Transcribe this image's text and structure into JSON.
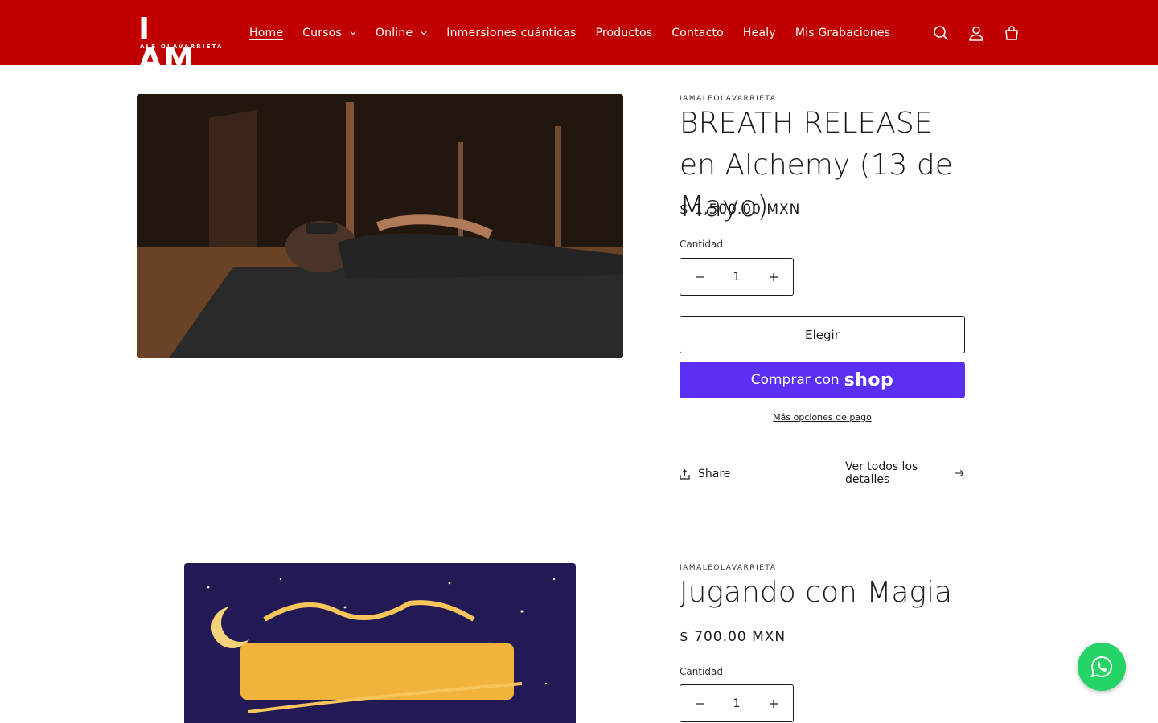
{
  "header": {
    "logo_text": "I AM",
    "logo_subtext": "ALE OLAVARRIETA",
    "nav": [
      {
        "label": "Home",
        "active": true,
        "dropdown": false
      },
      {
        "label": "Cursos",
        "active": false,
        "dropdown": true
      },
      {
        "label": "Online",
        "active": false,
        "dropdown": true
      },
      {
        "label": "Inmersiones cuánticas",
        "active": false,
        "dropdown": false
      },
      {
        "label": "Productos",
        "active": false,
        "dropdown": false
      },
      {
        "label": "Contacto",
        "active": false,
        "dropdown": false
      },
      {
        "label": "Healy",
        "active": false,
        "dropdown": false
      },
      {
        "label": "Mis Grabaciones",
        "active": false,
        "dropdown": false
      }
    ],
    "icons": [
      "search-icon",
      "account-icon",
      "cart-icon"
    ],
    "bg_color": "#c00000"
  },
  "products": [
    {
      "vendor": "IAMALEOLAVARRIETA",
      "title": "BREATH RELEASE en Alchemy (13 de Mayo)",
      "price": "$ 1,500.00 MXN",
      "quantity_label": "Cantidad",
      "quantity": "1",
      "choose_label": "Elegir",
      "shop_pay_prefix": "Comprar con",
      "shop_pay_brand": "shop",
      "more_payment": "Más opciones de pago",
      "share_label": "Share",
      "details_label": "Ver todos los detalles"
    },
    {
      "vendor": "IAMALEOLAVARRIETA",
      "title": "Jugando con Magia",
      "price": "$ 700.00 MXN",
      "quantity_label": "Cantidad",
      "quantity": "1"
    }
  ],
  "colors": {
    "accent": "#c00000",
    "shop_pay": "#5a31f4",
    "whatsapp": "#25d366"
  }
}
